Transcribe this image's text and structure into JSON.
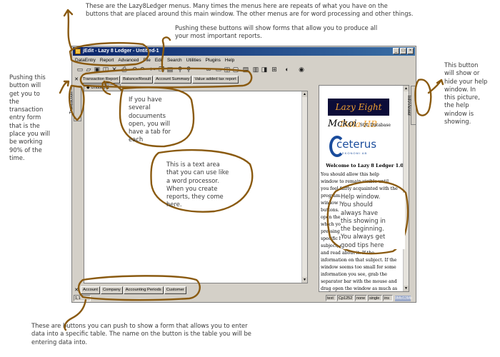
{
  "annotations": {
    "menus": [
      "These are the Lazy8Ledger menus.  Many times the menus here are repeats of what you have on the",
      "buttons that are placed around this main window.  The other menus are for word processing and other things."
    ],
    "reports": [
      "Pushing these buttons  will show forms that allow you to produce all",
      "your most important reports."
    ],
    "transaction": [
      "Pushing this",
      "button will",
      "get you to",
      "the",
      "transaction",
      "entry form",
      "that is the",
      "place you will",
      "be working",
      "90% of the",
      "time."
    ],
    "help_toggle": [
      "This button",
      "will show or",
      "hide your help",
      "window.  In",
      "this picture,",
      "the help",
      "window is",
      "showing."
    ],
    "tabs": [
      "If you have",
      "several",
      "docuuments",
      "open, you will",
      "have a tab for",
      "each"
    ],
    "text_area": [
      "This is a text area",
      "that you can use like",
      "a word processor.",
      "When you create",
      "reports, they come",
      "here."
    ],
    "help_window": [
      "Help window.",
      "You should",
      "always have",
      "this showing in",
      "the beginning.",
      "You always get",
      "good tips here"
    ],
    "entry_buttons": [
      "These are buttons you can push to show a form that allows you to enter",
      "data into a specific table.  The name on the button is the table you will be",
      "entering data into."
    ]
  },
  "window": {
    "title": "jEdit - Lazy 8 Ledger - Untitled-1",
    "menus": [
      "DataEntry",
      "Report",
      "Advanced",
      "File",
      "Edit",
      "Search",
      "Utilities",
      "Plugins",
      "Help"
    ],
    "report_buttons": [
      "Transaction Report",
      "Balance/Result",
      "Account Summary",
      "Value added tax report"
    ],
    "side_left_tab": "Transaction",
    "side_right_tab": "InfoViewer",
    "doc_tab": "Untitled-1",
    "entry_buttons": [
      "Account",
      "Company",
      "Accounting Periods",
      "Customer"
    ],
    "status": {
      "position": "1,1",
      "mode": "text",
      "encoding": "Cp1252",
      "fold": "none",
      "wrap": "single",
      "ins": "ins",
      "memory": "9Mb/13Mb",
      "memory_fraction": 0.69
    }
  },
  "help": {
    "logo1": "Lazy Eight Data HB",
    "logo2_main": "Mckoi",
    "logo2_sub": "SQL Database",
    "logo3_main": "ceterus",
    "logo3_sub": "EKONOMI AB",
    "welcome": "Welcome to Lazy 8 Ledger 1.0!",
    "body": "You should allow this help window to remain visible until you feel fairly acquainted with the program. At the top of this window you can see different buttons. Pressing on them will open the corresponding help text, which you can also navigate by pressing on the links. To get specific help information on a subject, click on the help window and read about it. If the information on that subject. If the window seems too small for some information you see, grab the separator bar with the mouse and drag open the window as much as you need."
  }
}
